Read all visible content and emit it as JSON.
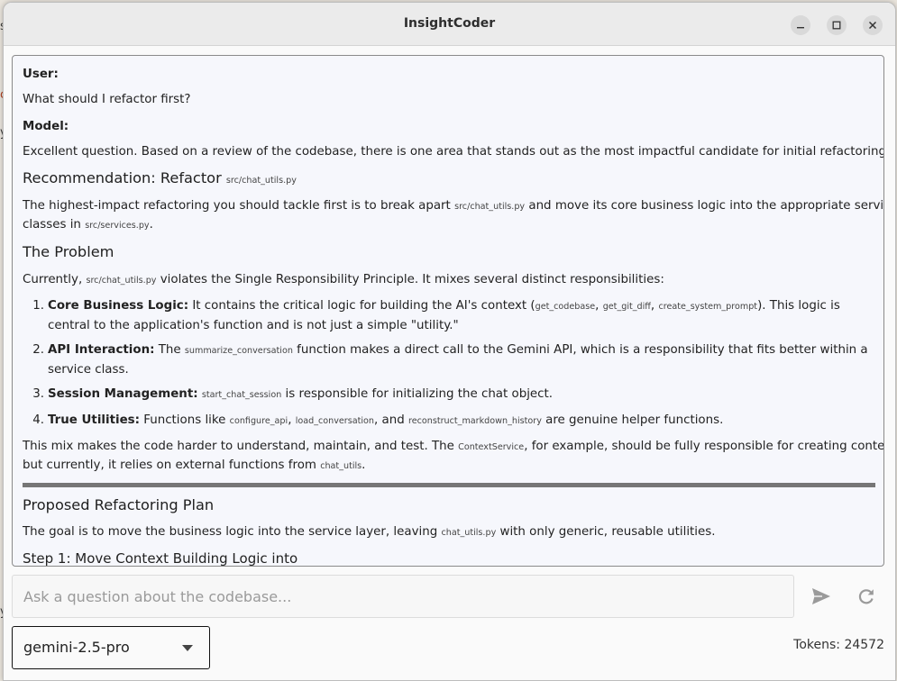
{
  "window": {
    "title": "InsightCoder"
  },
  "desktop_fragments": [
    "s",
    "c",
    "y",
    "y"
  ],
  "chat": {
    "user_label": "User:",
    "user_message": "What should I refactor first?",
    "model_label": "Model:",
    "intro": "Excellent question. Based on a review of the codebase, there is one area that stands out as the most impactful candidate for initial refactoring.",
    "rec_heading_text": "Recommendation: Refactor ",
    "rec_heading_code": "src/chat_utils.py",
    "rec_p_a": "The highest-impact refactoring you should tackle first is to break apart ",
    "rec_p_code1": "src/chat_utils.py",
    "rec_p_b": " and move its core business logic into the appropriate service",
    "rec_p_c": "classes in ",
    "rec_p_code2": "src/services.py",
    "rec_p_d": ".",
    "problem_heading": "The Problem",
    "problem_a": "Currently, ",
    "problem_code": "src/chat_utils.py",
    "problem_b": " violates the Single Responsibility Principle. It mixes several distinct responsibilities:",
    "items": [
      {
        "num": "1.",
        "bold": "Core Business Logic:",
        "a": " It contains the critical logic for building the AI's context (",
        "code1": "get_codebase",
        "sep1": ", ",
        "code2": "get_git_diff",
        "sep2": ", ",
        "code3": "create_system_prompt",
        "b": "). This logic is central to the application's function and is not just a simple \"utility.\""
      },
      {
        "num": "2.",
        "bold": "API Interaction:",
        "a": " The ",
        "code1": "summarize_conversation",
        "b": " function makes a direct call to the Gemini API, which is a responsibility that fits better within a service class."
      },
      {
        "num": "3.",
        "bold": "Session Management:",
        "a": " ",
        "code1": "start_chat_session",
        "b": " is responsible for initializing the chat object."
      },
      {
        "num": "4.",
        "bold": "True Utilities:",
        "a": " Functions like ",
        "code1": "configure_api",
        "sep1": ", ",
        "code2": "load_conversation",
        "sep2": ", and ",
        "code3": "reconstruct_markdown_history",
        "b": " are genuine helper functions."
      }
    ],
    "mix_a": "This mix makes the code harder to understand, maintain, and test. The ",
    "mix_code1": "ContextService",
    "mix_b": ", for example, should be fully responsible for creating context,",
    "mix_c": "but currently, it relies on external functions from ",
    "mix_code2": "chat_utils",
    "mix_d": ".",
    "plan_heading": "Proposed Refactoring Plan",
    "plan_a": "The goal is to move the business logic into the service layer, leaving ",
    "plan_code": "chat_utils.py",
    "plan_b": " with only generic, reusable utilities.",
    "step_heading": "Step 1: Move Context Building Logic into"
  },
  "input": {
    "placeholder": "Ask a question about the codebase...",
    "value": ""
  },
  "icons": {
    "send": "send-icon",
    "refresh": "refresh-icon",
    "dropdown": "caret-down-icon"
  },
  "model_select": {
    "selected": "gemini-2.5-pro"
  },
  "status": {
    "tokens": "Tokens: 24572"
  },
  "colors": {
    "chat_bg": "#f6f7fc",
    "divider": "#767676",
    "titlebar": "#ebebeb"
  }
}
